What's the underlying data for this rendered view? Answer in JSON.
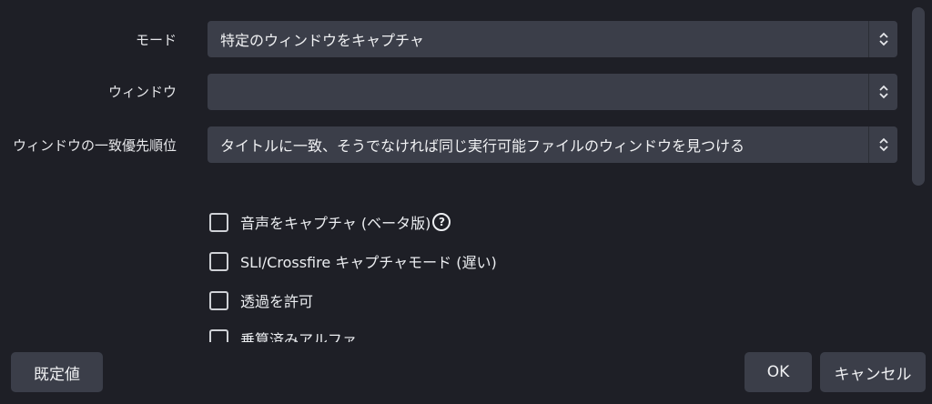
{
  "settings": {
    "mode": {
      "label": "モード",
      "value": "特定のウィンドウをキャプチャ"
    },
    "window": {
      "label": "ウィンドウ",
      "value": ""
    },
    "priority": {
      "label": "ウィンドウの一致優先順位",
      "value": "タイトルに一致、そうでなければ同じ実行可能ファイルのウィンドウを見つける"
    }
  },
  "checkboxes": [
    {
      "label": "音声をキャプチャ (ベータ版)",
      "checked": false,
      "help_icon": "question-circle-icon"
    },
    {
      "label": "SLI/Crossfire キャプチャモード (遅い)",
      "checked": false
    },
    {
      "label": "透過を許可",
      "checked": false
    },
    {
      "label": "乗算済みアルファ",
      "checked": false
    }
  ],
  "help_glyph": "?",
  "footer": {
    "defaults_label": "既定値",
    "ok_label": "OK",
    "cancel_label": "キャンセル"
  },
  "colors": {
    "background": "#1e1f26",
    "control": "#3b3e49",
    "text": "#e6e7ea"
  }
}
